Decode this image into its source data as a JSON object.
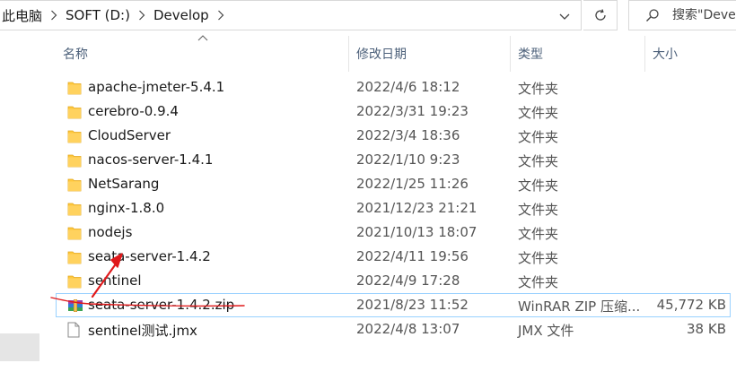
{
  "address": {
    "breadcrumbs": [
      "此电脑",
      "SOFT (D:)",
      "Develop"
    ]
  },
  "search": {
    "placeholder": "搜索\"Develop\""
  },
  "columns": {
    "name": "名称",
    "date": "修改日期",
    "type": "类型",
    "size": "大小"
  },
  "rows": [
    {
      "name": "apache-jmeter-5.4.1",
      "date": "2022/4/6 18:12",
      "type": "文件夹",
      "size": "",
      "icon": "folder-icon"
    },
    {
      "name": "cerebro-0.9.4",
      "date": "2022/3/31 19:23",
      "type": "文件夹",
      "size": "",
      "icon": "folder-icon"
    },
    {
      "name": "CloudServer",
      "date": "2022/3/4 18:36",
      "type": "文件夹",
      "size": "",
      "icon": "folder-icon"
    },
    {
      "name": "nacos-server-1.4.1",
      "date": "2022/1/10 9:23",
      "type": "文件夹",
      "size": "",
      "icon": "folder-icon"
    },
    {
      "name": "NetSarang",
      "date": "2022/1/25 11:26",
      "type": "文件夹",
      "size": "",
      "icon": "folder-icon"
    },
    {
      "name": "nginx-1.8.0",
      "date": "2021/12/23 21:21",
      "type": "文件夹",
      "size": "",
      "icon": "folder-icon"
    },
    {
      "name": "nodejs",
      "date": "2021/10/13 18:07",
      "type": "文件夹",
      "size": "",
      "icon": "folder-icon"
    },
    {
      "name": "seata-server-1.4.2",
      "date": "2022/4/11 19:56",
      "type": "文件夹",
      "size": "",
      "icon": "folder-icon"
    },
    {
      "name": "sentinel",
      "date": "2022/4/9 17:28",
      "type": "文件夹",
      "size": "",
      "icon": "folder-icon"
    },
    {
      "name": "seata-server-1.4.2.zip",
      "date": "2021/8/23 11:52",
      "type": "WinRAR ZIP 压缩...",
      "size": "45,772 KB",
      "icon": "winrar-archive-icon"
    },
    {
      "name": "sentinel测试.jmx",
      "date": "2022/4/8 13:07",
      "type": "JMX 文件",
      "size": "38 KB",
      "icon": "file-icon"
    }
  ],
  "colors": {
    "folder": "#ffc83d",
    "annotation": "#e0191b",
    "selection_border": "#99d1ff",
    "header_text": "#4c607a"
  }
}
